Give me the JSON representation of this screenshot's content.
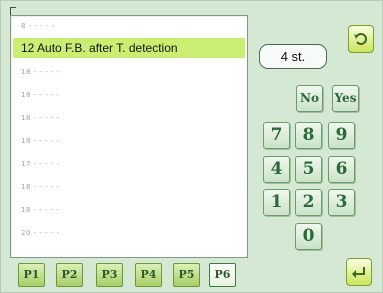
{
  "list": {
    "rows": [
      {
        "label": "8 - - - - -"
      },
      {
        "label": "12 Auto F.B. after T. detection"
      },
      {
        "label": "18 - - - - -"
      },
      {
        "label": "18 - - - - -"
      },
      {
        "label": "18 - - - - -"
      },
      {
        "label": "18 - - - - -"
      },
      {
        "label": "17 - - - - -"
      },
      {
        "label": "18 - - - - -"
      },
      {
        "label": "18 - - - - -"
      },
      {
        "label": "20 - - - - -"
      }
    ],
    "selected_index": 1
  },
  "status": {
    "value": "4 st."
  },
  "keypad": {
    "no_label": "No",
    "yes_label": "Yes",
    "keys": [
      "7",
      "8",
      "9",
      "4",
      "5",
      "6",
      "1",
      "2",
      "3",
      "0"
    ]
  },
  "tabs": [
    "P1",
    "P2",
    "P3",
    "P4",
    "P5",
    "P6"
  ],
  "active_tab": "P6",
  "icons": {
    "top_right": "refresh-arrow-icon",
    "bottom_right": "return-arrow-icon"
  },
  "colors": {
    "accent": "#c9ee72",
    "key_text": "#2b6a37",
    "background": "#d4e8d4"
  }
}
